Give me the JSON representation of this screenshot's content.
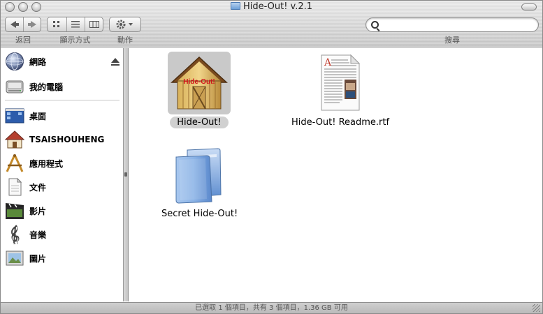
{
  "window": {
    "title": "Hide-Out! v.2.1"
  },
  "toolbar": {
    "back_label": "返回",
    "view_label": "顯示方式",
    "action_label": "動作",
    "search_label": "搜尋",
    "search_value": ""
  },
  "sidebar": {
    "items": [
      {
        "label": "網路",
        "icon": "network-globe-icon"
      },
      {
        "label": "我的電腦",
        "icon": "hard-drive-icon"
      },
      {
        "label": "桌面",
        "icon": "desktop-icon"
      },
      {
        "label": "TSAISHOUHENG",
        "icon": "home-icon"
      },
      {
        "label": "應用程式",
        "icon": "applications-icon"
      },
      {
        "label": "文件",
        "icon": "documents-icon"
      },
      {
        "label": "影片",
        "icon": "movies-icon"
      },
      {
        "label": "音樂",
        "icon": "music-icon"
      },
      {
        "label": "圖片",
        "icon": "pictures-icon"
      }
    ]
  },
  "files": [
    {
      "name": "Hide-Out!",
      "icon": "barn-app-icon",
      "icon_text": "Hide-Out!",
      "selected": true
    },
    {
      "name": "Hide-Out! Readme.rtf",
      "icon": "rtf-document-icon",
      "selected": false
    },
    {
      "name": "Secret Hide-Out!",
      "icon": "folder-icon",
      "selected": false
    }
  ],
  "status": {
    "text": "已選取 1 個項目，共有 3 個項目，1.36 GB 可用"
  },
  "colors": {
    "selection": "#c9c9c9",
    "folder_blue": "#7fa9df",
    "metal_top": "#e9e9e9",
    "metal_bottom": "#c6c6c6"
  }
}
